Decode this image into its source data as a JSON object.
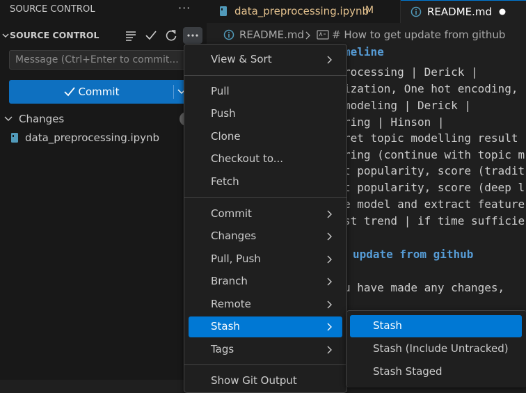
{
  "sidebar": {
    "title": "SOURCE CONTROL",
    "section_label": "SOURCE CONTROL",
    "message_placeholder": "Message (Ctrl+Enter to commit...",
    "commit_label": "Commit",
    "changes_label": "Changes",
    "changed_file": "data_preprocessing.ipynb"
  },
  "tabs": [
    {
      "label": "data_preprocessing.ipynb",
      "badge": "M"
    },
    {
      "label": "README.md",
      "badge": ""
    }
  ],
  "breadcrumb": {
    "file": "README.md",
    "section": "# How to get update from github"
  },
  "code_lines": [
    "meline",
    "rocessing | Derick |",
    "ization, One hot encoding,",
    "modeling | Derick |",
    "ring | Hinson |",
    "ret topic modelling result",
    "ring (continue with topic m",
    "t popularity, score (tradit",
    "t popularity, score (deep l",
    "e model and extract feature",
    "st trend | if time sufficie",
    "update from github",
    "u have made any changes,"
  ],
  "menu": {
    "items": [
      {
        "label": "View & Sort",
        "submenu": true
      },
      {
        "label": "Pull",
        "submenu": false
      },
      {
        "label": "Push",
        "submenu": false
      },
      {
        "label": "Clone",
        "submenu": false
      },
      {
        "label": "Checkout to...",
        "submenu": false
      },
      {
        "label": "Fetch",
        "submenu": false
      },
      {
        "label": "Commit",
        "submenu": true
      },
      {
        "label": "Changes",
        "submenu": true
      },
      {
        "label": "Pull, Push",
        "submenu": true
      },
      {
        "label": "Branch",
        "submenu": true
      },
      {
        "label": "Remote",
        "submenu": true
      },
      {
        "label": "Stash",
        "submenu": true,
        "active": true
      },
      {
        "label": "Tags",
        "submenu": true
      },
      {
        "label": "Show Git Output",
        "submenu": false
      }
    ]
  },
  "submenu": {
    "items": [
      {
        "label": "Stash",
        "active": true
      },
      {
        "label": "Stash (Include Untracked)"
      },
      {
        "label": "Stash Staged"
      }
    ]
  },
  "colors": {
    "accent": "#0078d4",
    "commit_button": "#0e70c0",
    "modified_badge": "#e2c08d",
    "heading": "#569cd6"
  }
}
